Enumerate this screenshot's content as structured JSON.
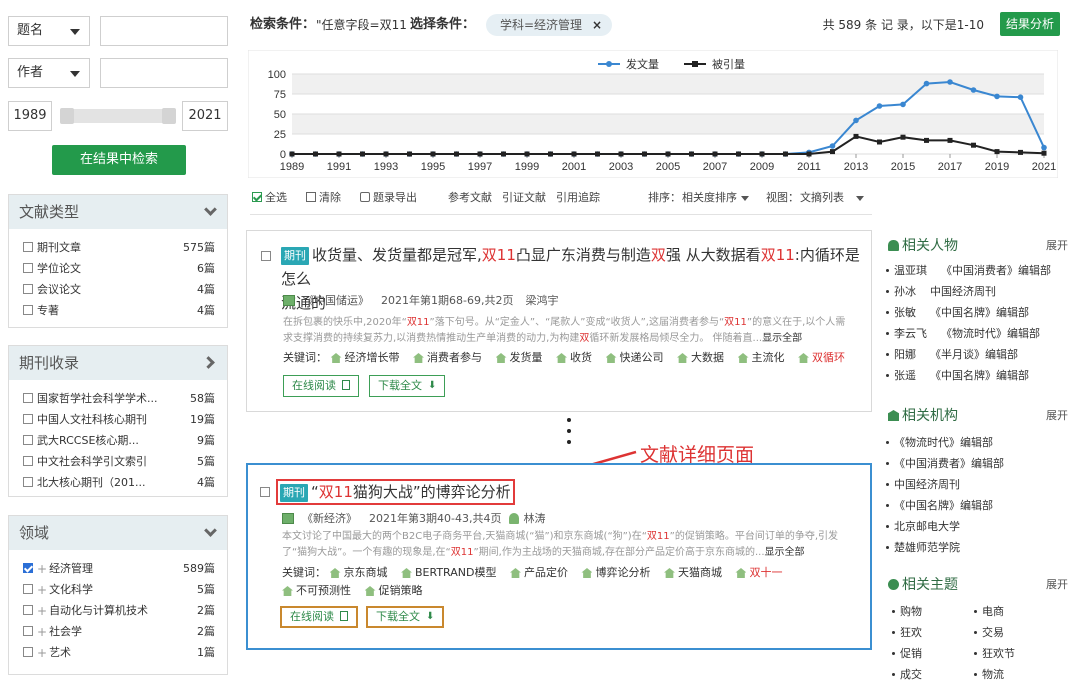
{
  "search": {
    "field1": "题名",
    "field2": "作者",
    "year_from": "1989",
    "year_to": "2021",
    "search_in_results": "在结果中检索"
  },
  "doc_type": {
    "title": "文献类型",
    "items": [
      {
        "label": "期刊文章",
        "count": "575篇"
      },
      {
        "label": "学位论文",
        "count": "6篇"
      },
      {
        "label": "会议论文",
        "count": "4篇"
      },
      {
        "label": "专著",
        "count": "4篇"
      }
    ]
  },
  "journal_index": {
    "title": "期刊收录",
    "items": [
      {
        "label": "国家哲学社会科学学术...",
        "count": "58篇"
      },
      {
        "label": "中国人文社科核心期刊",
        "count": "19篇"
      },
      {
        "label": "武大RCCSE核心期...",
        "count": "9篇"
      },
      {
        "label": "中文社会科学引文索引",
        "count": "5篇"
      },
      {
        "label": "北大核心期刊（201...",
        "count": "4篇"
      }
    ]
  },
  "field": {
    "title": "领域",
    "items": [
      {
        "label": "经济管理",
        "count": "589篇",
        "checked": true
      },
      {
        "label": "文化科学",
        "count": "5篇",
        "checked": false
      },
      {
        "label": "自动化与计算机技术",
        "count": "2篇",
        "checked": false
      },
      {
        "label": "社会学",
        "count": "2篇",
        "checked": false
      },
      {
        "label": "艺术",
        "count": "1篇",
        "checked": false
      }
    ]
  },
  "header": {
    "condition_label": "检索条件：",
    "condition_value": "\"任意字段=双11 \"",
    "select_label": "选择条件：",
    "tag": "学科=经济管理",
    "tag_close": "×",
    "total": "共 589 条 记 录，以下是1-10",
    "analyze": "结果分析"
  },
  "chart_data": {
    "type": "line",
    "x": [
      "1989",
      "1990",
      "1991",
      "1992",
      "1993",
      "1994",
      "1995",
      "1996",
      "1997",
      "1998",
      "1999",
      "2000",
      "2001",
      "2002",
      "2003",
      "2004",
      "2005",
      "2006",
      "2007",
      "2008",
      "2009",
      "2010",
      "2011",
      "2012",
      "2013",
      "2014",
      "2015",
      "2016",
      "2017",
      "2018",
      "2019",
      "2020",
      "2021"
    ],
    "x_ticks": [
      "1989",
      "1991",
      "1993",
      "1995",
      "1997",
      "1999",
      "2001",
      "2003",
      "2005",
      "2007",
      "2009",
      "2011",
      "2013",
      "2015",
      "2017",
      "2019",
      "2021"
    ],
    "y_ticks": [
      "0",
      "25",
      "50",
      "75",
      "100"
    ],
    "ylim": [
      0,
      100
    ],
    "grid": true,
    "legend": "top-right",
    "series": [
      {
        "name": "发文量",
        "color": "#3a87d1",
        "values": [
          0,
          0,
          0,
          0,
          0,
          0,
          0,
          0,
          0,
          0,
          0,
          0,
          0,
          0,
          0,
          0,
          0,
          0,
          0,
          0,
          0,
          0,
          2,
          10,
          42,
          60,
          62,
          88,
          90,
          80,
          72,
          71,
          8
        ]
      },
      {
        "name": "被引量",
        "color": "#222222",
        "values": [
          0,
          0,
          0,
          0,
          0,
          0,
          0,
          0,
          0,
          0,
          0,
          0,
          0,
          0,
          0,
          0,
          0,
          0,
          0,
          0,
          0,
          0,
          0,
          3,
          22,
          15,
          21,
          17,
          17,
          11,
          3,
          2,
          1
        ]
      }
    ]
  },
  "toolbar": {
    "select_all": "全选",
    "clear": "清除",
    "export": "题录导出",
    "ref": "参考文献",
    "cite": "引证文献",
    "trace": "引用追踪",
    "sort_label": "排序：",
    "sort_value": "相关度排序",
    "view_label": "视图：",
    "view_value": "文摘列表"
  },
  "result1": {
    "badge": "期刊",
    "title_parts": [
      "收货量、发货量都是冠军,",
      "双11",
      "凸显广东消费与制造",
      "双",
      "强 从大数据看",
      "双11",
      ":内循环是怎么",
      "流通的"
    ],
    "source": "《中国储运》",
    "issue": "2021年第1期68-69,共2页",
    "author": "梁鸿宇",
    "abs_parts": [
      "在拆包裹的快乐中,2020年“",
      "双11",
      "”落下句号。从“定金人”、“尾款人”变成“收货人”,这届消费者参与“",
      "双11",
      "”的意义在于,以个人需",
      "求支撑消费的持续复苏力,以消费热情推动生产单消费的动力,为构建",
      "双",
      "循环新发展格局倾尽全力。 伴随着直...",
      "显示全部"
    ],
    "kw_label": "关键词：",
    "keywords": [
      "经济增长带",
      "消费者参与",
      "发货量",
      "收货",
      "快递公司",
      "大数据",
      "主流化",
      "双循环"
    ],
    "read": "在线阅读",
    "download": "下载全文"
  },
  "result2": {
    "badge": "期刊",
    "title_parts": [
      "“",
      "双11",
      "猫狗大战”的博弈论分析"
    ],
    "source": "《新经济》",
    "issue": "2021年第3期40-43,共4页",
    "author": "林涛",
    "abs_parts": [
      "本文讨论了中国最大的两个B2C电子商务平台,天猫商城(“猫”)和京东商城(“狗”)在“",
      "双11",
      "”的促销策略。平台间订单的争夺,引发",
      "了“猫狗大战”。一个有趣的现象是,在“",
      "双11",
      "”期间,作为主战场的天猫商城,存在部分产品定价高于京东商城的...",
      "显示全部"
    ],
    "kw_label": "关键词：",
    "keywords": [
      "京东商城",
      "BERTRAND模型",
      "产品定价",
      "博弈论分析",
      "天猫商城",
      "双十一",
      "不可预测性",
      "促销策略"
    ],
    "read": "在线阅读",
    "download": "下载全文"
  },
  "annotation": "文献详细页面",
  "related_people": {
    "title": "相关人物",
    "expand": "展开",
    "items": [
      {
        "name": "温亚琪",
        "aff": "《中国消费者》编辑部"
      },
      {
        "name": "孙冰",
        "aff": "中国经济周刊"
      },
      {
        "name": "张敏",
        "aff": "《中国名牌》编辑部"
      },
      {
        "name": "李云飞",
        "aff": "《物流时代》编辑部"
      },
      {
        "name": "阳娜",
        "aff": "《半月谈》编辑部"
      },
      {
        "name": "张遥",
        "aff": "《中国名牌》编辑部"
      }
    ]
  },
  "related_orgs": {
    "title": "相关机构",
    "expand": "展开",
    "items": [
      "《物流时代》编辑部",
      "《中国消费者》编辑部",
      "中国经济周刊",
      "《中国名牌》编辑部",
      "北京邮电大学",
      "楚雄师范学院"
    ]
  },
  "related_topics": {
    "title": "相关主题",
    "expand": "展开",
    "items": [
      "购物",
      "电商",
      "狂欢",
      "交易",
      "促销",
      "狂欢节",
      "成交",
      "物流"
    ]
  }
}
